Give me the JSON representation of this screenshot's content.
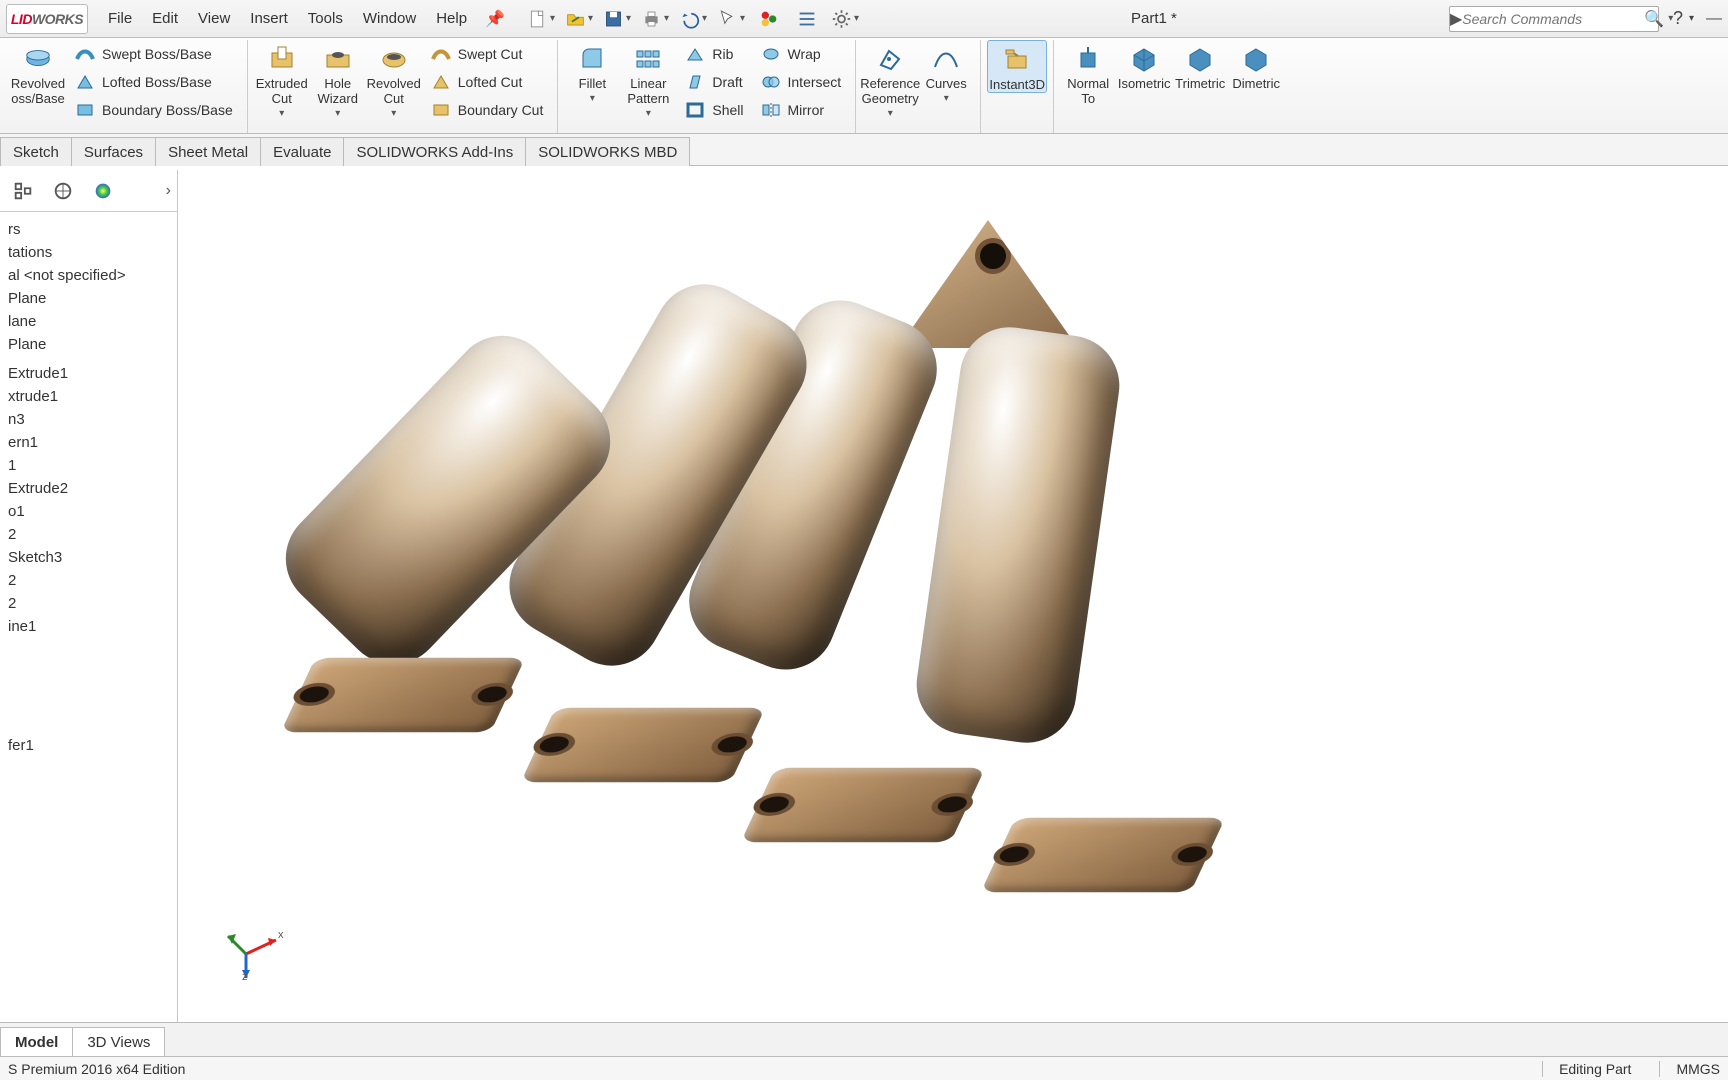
{
  "app": {
    "logo_l": "LID",
    "logo_w": "WORKS",
    "title": "Part1 *"
  },
  "menu": {
    "file": "File",
    "edit": "Edit",
    "view": "View",
    "insert": "Insert",
    "tools": "Tools",
    "window": "Window",
    "help": "Help"
  },
  "search": {
    "placeholder": "Search Commands"
  },
  "ribbon": {
    "revolved_boss": "Revolved\noss/Base",
    "swept_boss": "Swept Boss/Base",
    "lofted_boss": "Lofted Boss/Base",
    "boundary_boss": "Boundary Boss/Base",
    "extruded_cut": "Extruded Cut",
    "hole_wizard": "Hole Wizard",
    "revolved_cut": "Revolved Cut",
    "swept_cut": "Swept Cut",
    "lofted_cut": "Lofted Cut",
    "boundary_cut": "Boundary Cut",
    "fillet": "Fillet",
    "linear_pattern": "Linear Pattern",
    "rib": "Rib",
    "draft": "Draft",
    "shell": "Shell",
    "wrap": "Wrap",
    "intersect": "Intersect",
    "mirror": "Mirror",
    "ref_geom": "Reference Geometry",
    "curves": "Curves",
    "instant3d": "Instant3D",
    "normal_to": "Normal To",
    "isometric": "Isometric",
    "trimetric": "Trimetric",
    "dimetric": "Dimetric"
  },
  "cmdtabs": {
    "sketch": "Sketch",
    "surfaces": "Surfaces",
    "sheetmetal": "Sheet Metal",
    "evaluate": "Evaluate",
    "addins": "SOLIDWORKS Add-Ins",
    "mbd": "SOLIDWORKS MBD"
  },
  "tree": {
    "items": [
      "rs",
      "tations",
      "al  <not specified>",
      "Plane",
      "lane",
      "Plane",
      "",
      "Extrude1",
      "xtrude1",
      "n3",
      "ern1",
      "1",
      "Extrude2",
      "o1",
      "2",
      "Sketch3",
      "2",
      "2",
      "ine1",
      "",
      "fer1"
    ]
  },
  "bottom": {
    "model": "Model",
    "views": "3D Views"
  },
  "status": {
    "edition": "S Premium 2016 x64 Edition",
    "editing": "Editing Part",
    "units": "MMGS"
  },
  "triad": {
    "x": "x",
    "z": "z"
  }
}
